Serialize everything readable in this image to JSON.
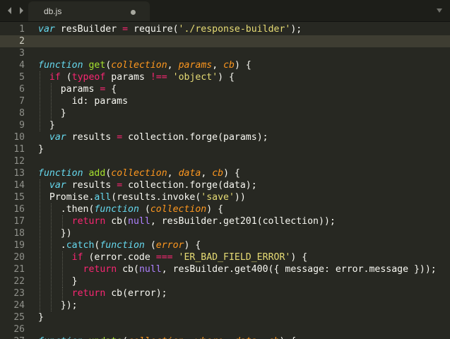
{
  "tab": {
    "title": "db.js"
  },
  "colors": {
    "background": "#272822",
    "keyword": "#f92672",
    "string": "#e6db74",
    "number_literal": "#ae81ff",
    "function_name": "#a6e22e",
    "parameter": "#fd971f",
    "storage": "#66d9ef",
    "text": "#f8f8f2"
  },
  "editor": {
    "active_line": 2,
    "lines": [
      {
        "num": "1",
        "tokens": [
          [
            "st",
            "var"
          ],
          [
            "t",
            " resBuilder "
          ],
          [
            "k",
            "="
          ],
          [
            "t",
            " require("
          ],
          [
            "s",
            "'./response-builder'"
          ],
          [
            "t",
            ");"
          ]
        ]
      },
      {
        "num": "2",
        "tokens": []
      },
      {
        "num": "3",
        "tokens": []
      },
      {
        "num": "4",
        "tokens": [
          [
            "st",
            "function"
          ],
          [
            "t",
            " "
          ],
          [
            "f",
            "get"
          ],
          [
            "t",
            "("
          ],
          [
            "p",
            "collection"
          ],
          [
            "t",
            ", "
          ],
          [
            "p",
            "params"
          ],
          [
            "t",
            ", "
          ],
          [
            "p",
            "cb"
          ],
          [
            "t",
            ") {"
          ]
        ]
      },
      {
        "num": "5",
        "tokens": [
          [
            "t",
            "  "
          ],
          [
            "k",
            "if"
          ],
          [
            "t",
            " ("
          ],
          [
            "k",
            "typeof"
          ],
          [
            "t",
            " params "
          ],
          [
            "k",
            "!=="
          ],
          [
            "t",
            " "
          ],
          [
            "s",
            "'object'"
          ],
          [
            "t",
            ") {"
          ]
        ]
      },
      {
        "num": "6",
        "tokens": [
          [
            "t",
            "    params "
          ],
          [
            "k",
            "="
          ],
          [
            "t",
            " {"
          ]
        ]
      },
      {
        "num": "7",
        "tokens": [
          [
            "t",
            "      id: params"
          ]
        ]
      },
      {
        "num": "8",
        "tokens": [
          [
            "t",
            "    }"
          ]
        ]
      },
      {
        "num": "9",
        "tokens": [
          [
            "t",
            "  }"
          ]
        ]
      },
      {
        "num": "10",
        "tokens": [
          [
            "t",
            "  "
          ],
          [
            "st",
            "var"
          ],
          [
            "t",
            " results "
          ],
          [
            "k",
            "="
          ],
          [
            "t",
            " collection.forge(params);"
          ]
        ]
      },
      {
        "num": "11",
        "tokens": [
          [
            "t",
            "}"
          ]
        ]
      },
      {
        "num": "12",
        "tokens": []
      },
      {
        "num": "13",
        "tokens": [
          [
            "st",
            "function"
          ],
          [
            "t",
            " "
          ],
          [
            "f",
            "add"
          ],
          [
            "t",
            "("
          ],
          [
            "p",
            "collection"
          ],
          [
            "t",
            ", "
          ],
          [
            "p",
            "data"
          ],
          [
            "t",
            ", "
          ],
          [
            "p",
            "cb"
          ],
          [
            "t",
            ") {"
          ]
        ]
      },
      {
        "num": "14",
        "tokens": [
          [
            "t",
            "  "
          ],
          [
            "st",
            "var"
          ],
          [
            "t",
            " results "
          ],
          [
            "k",
            "="
          ],
          [
            "t",
            " collection.forge(data);"
          ]
        ]
      },
      {
        "num": "15",
        "tokens": [
          [
            "t",
            "  Promise."
          ],
          [
            "c",
            "all"
          ],
          [
            "t",
            "(results.invoke("
          ],
          [
            "s",
            "'save'"
          ],
          [
            "t",
            "))"
          ]
        ]
      },
      {
        "num": "16",
        "tokens": [
          [
            "t",
            "    .then("
          ],
          [
            "st",
            "function"
          ],
          [
            "t",
            " ("
          ],
          [
            "p",
            "collection"
          ],
          [
            "t",
            ") {"
          ]
        ]
      },
      {
        "num": "17",
        "tokens": [
          [
            "t",
            "      "
          ],
          [
            "k",
            "return"
          ],
          [
            "t",
            " cb("
          ],
          [
            "n",
            "null"
          ],
          [
            "t",
            ", resBuilder.get201(collection));"
          ]
        ]
      },
      {
        "num": "18",
        "tokens": [
          [
            "t",
            "    })"
          ]
        ]
      },
      {
        "num": "19",
        "tokens": [
          [
            "t",
            "    ."
          ],
          [
            "c",
            "catch"
          ],
          [
            "t",
            "("
          ],
          [
            "st",
            "function"
          ],
          [
            "t",
            " ("
          ],
          [
            "p",
            "error"
          ],
          [
            "t",
            ") {"
          ]
        ]
      },
      {
        "num": "20",
        "tokens": [
          [
            "t",
            "      "
          ],
          [
            "k",
            "if"
          ],
          [
            "t",
            " (error.code "
          ],
          [
            "k",
            "==="
          ],
          [
            "t",
            " "
          ],
          [
            "s",
            "'ER_BAD_FIELD_ERROR'"
          ],
          [
            "t",
            ") {"
          ]
        ]
      },
      {
        "num": "21",
        "tokens": [
          [
            "t",
            "        "
          ],
          [
            "k",
            "return"
          ],
          [
            "t",
            " cb("
          ],
          [
            "n",
            "null"
          ],
          [
            "t",
            ", resBuilder.get400({ message: error.message }));"
          ]
        ]
      },
      {
        "num": "22",
        "tokens": [
          [
            "t",
            "      }"
          ]
        ]
      },
      {
        "num": "23",
        "tokens": [
          [
            "t",
            "      "
          ],
          [
            "k",
            "return"
          ],
          [
            "t",
            " cb(error);"
          ]
        ]
      },
      {
        "num": "24",
        "tokens": [
          [
            "t",
            "    });"
          ]
        ]
      },
      {
        "num": "25",
        "tokens": [
          [
            "t",
            "}"
          ]
        ]
      },
      {
        "num": "26",
        "tokens": []
      },
      {
        "num": "27",
        "tokens": [
          [
            "st",
            "function"
          ],
          [
            "t",
            " "
          ],
          [
            "f",
            "update"
          ],
          [
            "t",
            "("
          ],
          [
            "p",
            "collection"
          ],
          [
            "t",
            ", "
          ],
          [
            "p",
            "where"
          ],
          [
            "t",
            ", "
          ],
          [
            "p",
            "data"
          ],
          [
            "t",
            ", "
          ],
          [
            "p",
            "cb"
          ],
          [
            "t",
            ") {"
          ]
        ]
      }
    ]
  }
}
